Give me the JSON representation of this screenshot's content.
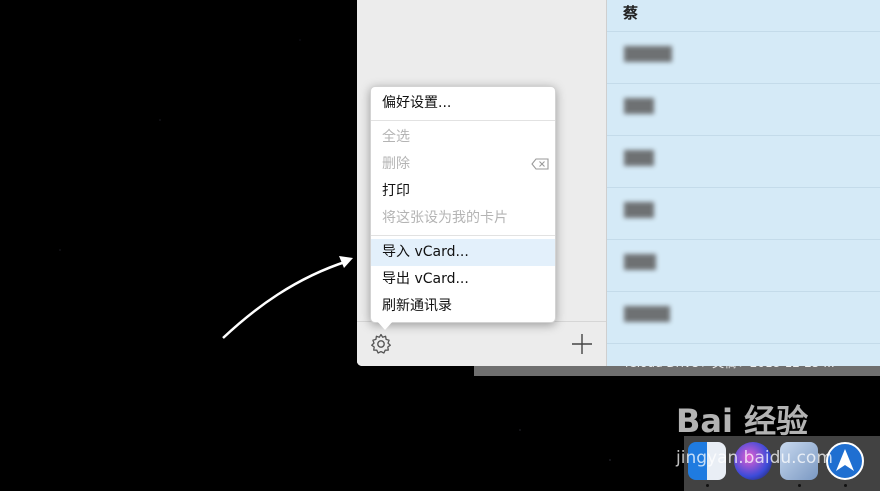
{
  "menu": {
    "items": [
      {
        "label": "偏好设置...",
        "enabled": true
      },
      {
        "label": "全选",
        "enabled": false
      },
      {
        "label": "删除",
        "enabled": false
      },
      {
        "label": "打印",
        "enabled": true
      },
      {
        "label": "将这张设为我的卡片",
        "enabled": false
      },
      {
        "label": "导入 vCard...",
        "enabled": true,
        "highlighted": true
      },
      {
        "label": "导出 vCard...",
        "enabled": true
      },
      {
        "label": "刷新通讯录",
        "enabled": true
      }
    ]
  },
  "contacts": {
    "first_visible_name": "蔡",
    "rows": [
      "",
      "",
      "",
      "",
      "",
      "",
      ""
    ]
  },
  "toolbar": {
    "settings_icon": "gear-icon",
    "add_icon": "plus-icon"
  },
  "background_window": {
    "path_text": "iCloud Drive  ▸  文稿  ▸  2018-12-25 ..."
  },
  "watermark": {
    "brand": "Bai 经验",
    "url": "jingyan.baidu.com"
  },
  "colors": {
    "contacts_bg": "#d5eaf7",
    "menu_highlight": "#e3f0fb",
    "disabled_text": "#b4b4b4"
  }
}
